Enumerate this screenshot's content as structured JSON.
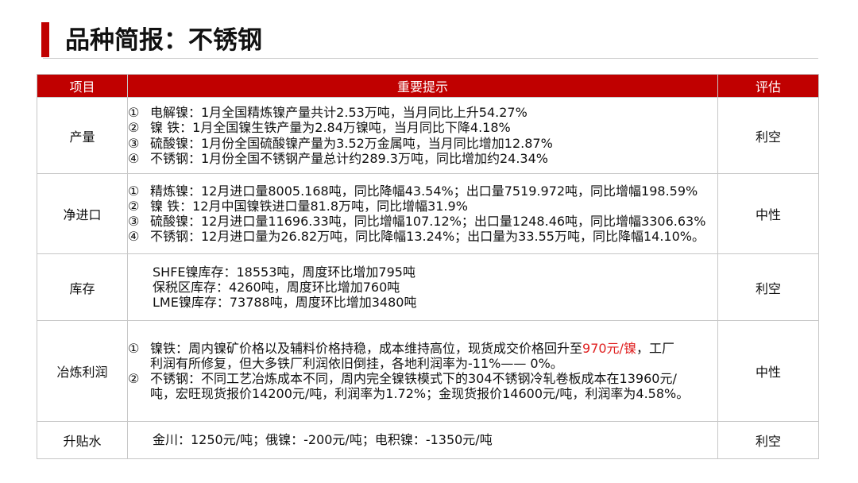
{
  "title": "品种简报：不锈钢",
  "table": {
    "headers": {
      "item": "项目",
      "tips": "重要提示",
      "eval": "评估"
    },
    "rows": [
      {
        "item": "产量",
        "lines": [
          {
            "num": "①",
            "text": "电解镍：1月全国精炼镍产量共计2.53万吨，当月同比上升54.27%"
          },
          {
            "num": "②",
            "text": "镍  铁：1月全国镍生铁产量为2.84万镍吨，当月同比下降4.18%"
          },
          {
            "num": "③",
            "text": "硫酸镍：1月份全国硫酸镍产量为3.52万金属吨，当月同比增加12.87%"
          },
          {
            "num": "④",
            "text": "不锈钢：1月份全国不锈钢产量总计约289.3万吨，同比增加约24.34%"
          }
        ],
        "eval": "利空"
      },
      {
        "item": "净进口",
        "lines": [
          {
            "num": "①",
            "text": "精炼镍：12月进口量8005.168吨，同比降幅43.54%；出口量7519.972吨，同比增幅198.59%"
          },
          {
            "num": "②",
            "text": "镍  铁：12月中国镍铁进口量81.8万吨，同比增幅31.9%"
          },
          {
            "num": "③",
            "text": "硫酸镍：12月进口量11696.33吨，同比增幅107.12%；出口量1248.46吨，同比增幅3306.63%"
          },
          {
            "num": "④",
            "text": "不锈钢：12月进口量为26.82万吨，同比降幅13.24%；出口量为33.55万吨，同比降幅14.10%。"
          }
        ],
        "eval": "中性"
      },
      {
        "item": "库存",
        "lines": [
          "SHFE镍库存：18553吨，周度环比增加795吨",
          "保税区库存：4260吨，周度环比增加760吨",
          "LME镍库存：73788吨，周度环比增加3480吨"
        ],
        "eval": "利空"
      },
      {
        "item": "冶炼利润",
        "para1": {
          "num": "①",
          "l1_pre": "镍铁：周内镍矿价格以及辅料价格持稳，成本维持高位，现货成交价格回升至",
          "l1_red": "970元/镍",
          "l1_post": "，工厂",
          "l2": "利润有所修复，但大多铁厂利润依旧倒挂，各地利润率为-11%—— 0%。"
        },
        "para2": {
          "num": "②",
          "l1": "不锈钢：不同工艺冶炼成本不同，周内完全镍铁模式下的304不锈钢冷轧卷板成本在13960元/",
          "l2": "吨，宏旺现货报价14200元/吨，利润率为1.72%；金现货报价14600元/吨，利润率为4.58%。"
        },
        "eval": "中性"
      },
      {
        "item": "升贴水",
        "text": "金川：1250元/吨；俄镍：-200元/吨；电积镍：-1350元/吨",
        "eval": "利空"
      }
    ]
  },
  "colors": {
    "accent": "#c00000",
    "highlight": "#e02020"
  }
}
